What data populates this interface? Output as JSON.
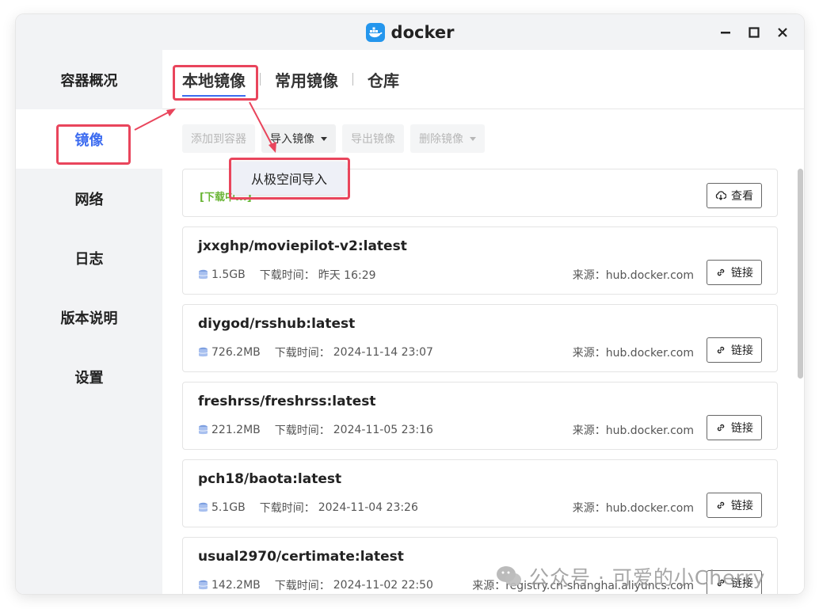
{
  "app": {
    "title": "docker",
    "brand_color": "#2496ed",
    "accent_color": "#3d6cf0"
  },
  "window_controls": [
    "minimize-icon",
    "maximize-icon",
    "close-icon"
  ],
  "sidebar": {
    "items": [
      {
        "label": "容器概况",
        "active": false
      },
      {
        "label": "镜像",
        "active": true
      },
      {
        "label": "网络",
        "active": false
      },
      {
        "label": "日志",
        "active": false
      },
      {
        "label": "版本说明",
        "active": false
      },
      {
        "label": "设置",
        "active": false
      }
    ]
  },
  "tabs": [
    {
      "label": "本地镜像",
      "active": true
    },
    {
      "label": "常用镜像",
      "active": false
    },
    {
      "label": "仓库",
      "active": false
    }
  ],
  "toolbar": {
    "add_to_container": "添加到容器",
    "import_image": "导入镜像",
    "export_image": "导出镜像",
    "delete_image": "删除镜像"
  },
  "import_menu": {
    "option": "从极空间导入"
  },
  "download_card": {
    "status": "[下载中...]",
    "view_label": "查看"
  },
  "labels": {
    "download_time": "下载时间：",
    "source": "来源：",
    "link": "链接"
  },
  "images": [
    {
      "name": "jxxghp/moviepilot-v2:latest",
      "size": "1.5GB",
      "time": "昨天 16:29",
      "source": "hub.docker.com"
    },
    {
      "name": "diygod/rsshub:latest",
      "size": "726.2MB",
      "time": "2024-11-14 23:07",
      "source": "hub.docker.com"
    },
    {
      "name": "freshrss/freshrss:latest",
      "size": "221.2MB",
      "time": "2024-11-05 23:16",
      "source": "hub.docker.com"
    },
    {
      "name": "pch18/baota:latest",
      "size": "5.1GB",
      "time": "2024-11-04 23:26",
      "source": "hub.docker.com"
    },
    {
      "name": "usual2970/certimate:latest",
      "size": "142.2MB",
      "time": "2024-11-02 22:50",
      "source": "registry.cn-shanghai.aliyuncs.com"
    }
  ],
  "watermark": {
    "text": "公众号 · 可爱的小Cherry"
  },
  "annotation_color": "#e9455c"
}
